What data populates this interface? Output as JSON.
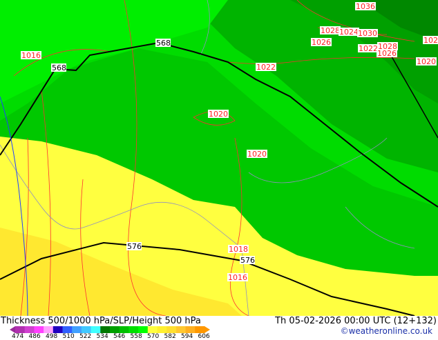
{
  "title": "Thickness 500/1000 hPa/SLP/Height 500 hPa",
  "date": "Th 05-02-2026 00:00 UTC (12+132)",
  "credit": "©weatheronline.co.uk",
  "legend": {
    "ticks": [
      "474",
      "486",
      "498",
      "510",
      "522",
      "534",
      "546",
      "558",
      "570",
      "582",
      "594",
      "606"
    ],
    "colors": [
      "#9a2c9a",
      "#b030b0",
      "#d040d0",
      "#ff40ff",
      "#ffa0ff",
      "#2000c0",
      "#3060ff",
      "#40a0ff",
      "#40c8ff",
      "#40ffff",
      "#007800",
      "#00a000",
      "#00c000",
      "#00e000",
      "#00ff00",
      "#ffff40",
      "#fff030",
      "#ffe030",
      "#ffc830",
      "#ffb020",
      "#ff9800"
    ]
  },
  "height_labels": [
    "568",
    "568",
    "576",
    "576"
  ],
  "slp_labels": [
    "1036",
    "1028",
    "1024",
    "1030",
    "1026",
    "1022",
    "1028",
    "1026",
    "1020",
    "1016",
    "1022",
    "1020",
    "1020",
    "1018",
    "1016",
    "102"
  ]
}
